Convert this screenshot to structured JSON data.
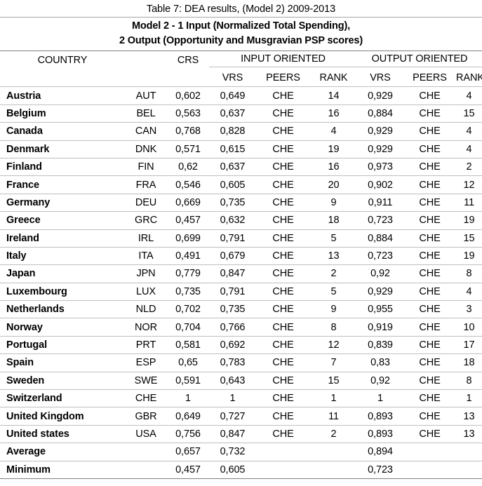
{
  "caption": "Table 7: DEA results, (Model 2) 2009-2013",
  "title": {
    "line1": "Model 2 - 1 Input (Normalized Total Spending),",
    "line2": "2 Output (Opportunity and Musgravian PSP scores)"
  },
  "header": {
    "country": "COUNTRY",
    "code": "",
    "crs": "CRS",
    "group_input": "INPUT ORIENTED",
    "group_output": "OUTPUT ORIENTED",
    "sub": {
      "input_vrs": "VRS",
      "input_peers": "PEERS",
      "input_rank": "RANK",
      "output_vrs": "VRS",
      "output_peers": "PEERS",
      "output_rank": "RANK"
    }
  },
  "rows": [
    {
      "country": "Austria",
      "code": "AUT",
      "crs": "0,602",
      "input_vrs": "0,649",
      "input_peers": "CHE",
      "input_rank": "14",
      "output_vrs": "0,929",
      "output_peers": "CHE",
      "output_rank": "4"
    },
    {
      "country": "Belgium",
      "code": "BEL",
      "crs": "0,563",
      "input_vrs": "0,637",
      "input_peers": "CHE",
      "input_rank": "16",
      "output_vrs": "0,884",
      "output_peers": "CHE",
      "output_rank": "15"
    },
    {
      "country": "Canada",
      "code": "CAN",
      "crs": "0,768",
      "input_vrs": "0,828",
      "input_peers": "CHE",
      "input_rank": "4",
      "output_vrs": "0,929",
      "output_peers": "CHE",
      "output_rank": "4"
    },
    {
      "country": "Denmark",
      "code": "DNK",
      "crs": "0,571",
      "input_vrs": "0,615",
      "input_peers": "CHE",
      "input_rank": "19",
      "output_vrs": "0,929",
      "output_peers": "CHE",
      "output_rank": "4"
    },
    {
      "country": "Finland",
      "code": "FIN",
      "crs": "0,62",
      "input_vrs": "0,637",
      "input_peers": "CHE",
      "input_rank": "16",
      "output_vrs": "0,973",
      "output_peers": "CHE",
      "output_rank": "2"
    },
    {
      "country": "France",
      "code": "FRA",
      "crs": "0,546",
      "input_vrs": "0,605",
      "input_peers": "CHE",
      "input_rank": "20",
      "output_vrs": "0,902",
      "output_peers": "CHE",
      "output_rank": "12"
    },
    {
      "country": "Germany",
      "code": "DEU",
      "crs": "0,669",
      "input_vrs": "0,735",
      "input_peers": "CHE",
      "input_rank": "9",
      "output_vrs": "0,911",
      "output_peers": "CHE",
      "output_rank": "11"
    },
    {
      "country": "Greece",
      "code": "GRC",
      "crs": "0,457",
      "input_vrs": "0,632",
      "input_peers": "CHE",
      "input_rank": "18",
      "output_vrs": "0,723",
      "output_peers": "CHE",
      "output_rank": "19"
    },
    {
      "country": "Ireland",
      "code": "IRL",
      "crs": "0,699",
      "input_vrs": "0,791",
      "input_peers": "CHE",
      "input_rank": "5",
      "output_vrs": "0,884",
      "output_peers": "CHE",
      "output_rank": "15"
    },
    {
      "country": "Italy",
      "code": "ITA",
      "crs": "0,491",
      "input_vrs": "0,679",
      "input_peers": "CHE",
      "input_rank": "13",
      "output_vrs": "0,723",
      "output_peers": "CHE",
      "output_rank": "19"
    },
    {
      "country": "Japan",
      "code": "JPN",
      "crs": "0,779",
      "input_vrs": "0,847",
      "input_peers": "CHE",
      "input_rank": "2",
      "output_vrs": "0,92",
      "output_peers": "CHE",
      "output_rank": "8"
    },
    {
      "country": "Luxembourg",
      "code": "LUX",
      "crs": "0,735",
      "input_vrs": "0,791",
      "input_peers": "CHE",
      "input_rank": "5",
      "output_vrs": "0,929",
      "output_peers": "CHE",
      "output_rank": "4"
    },
    {
      "country": "Netherlands",
      "code": "NLD",
      "crs": "0,702",
      "input_vrs": "0,735",
      "input_peers": "CHE",
      "input_rank": "9",
      "output_vrs": "0,955",
      "output_peers": "CHE",
      "output_rank": "3"
    },
    {
      "country": "Norway",
      "code": "NOR",
      "crs": "0,704",
      "input_vrs": "0,766",
      "input_peers": "CHE",
      "input_rank": "8",
      "output_vrs": "0,919",
      "output_peers": "CHE",
      "output_rank": "10"
    },
    {
      "country": "Portugal",
      "code": "PRT",
      "crs": "0,581",
      "input_vrs": "0,692",
      "input_peers": "CHE",
      "input_rank": "12",
      "output_vrs": "0,839",
      "output_peers": "CHE",
      "output_rank": "17"
    },
    {
      "country": "Spain",
      "code": "ESP",
      "crs": "0,65",
      "input_vrs": "0,783",
      "input_peers": "CHE",
      "input_rank": "7",
      "output_vrs": "0,83",
      "output_peers": "CHE",
      "output_rank": "18"
    },
    {
      "country": "Sweden",
      "code": "SWE",
      "crs": "0,591",
      "input_vrs": "0,643",
      "input_peers": "CHE",
      "input_rank": "15",
      "output_vrs": "0,92",
      "output_peers": "CHE",
      "output_rank": "8"
    },
    {
      "country": "Switzerland",
      "code": "CHE",
      "crs": "1",
      "input_vrs": "1",
      "input_peers": "CHE",
      "input_rank": "1",
      "output_vrs": "1",
      "output_peers": "CHE",
      "output_rank": "1"
    },
    {
      "country": "United Kingdom",
      "code": "GBR",
      "crs": "0,649",
      "input_vrs": "0,727",
      "input_peers": "CHE",
      "input_rank": "11",
      "output_vrs": "0,893",
      "output_peers": "CHE",
      "output_rank": "13"
    },
    {
      "country": "United states",
      "code": "USA",
      "crs": "0,756",
      "input_vrs": "0,847",
      "input_peers": "CHE",
      "input_rank": "2",
      "output_vrs": "0,893",
      "output_peers": "CHE",
      "output_rank": "13"
    }
  ],
  "summary": [
    {
      "country": "Average",
      "code": "",
      "crs": "0,657",
      "input_vrs": "0,732",
      "input_peers": "",
      "input_rank": "",
      "output_vrs": "0,894",
      "output_peers": "",
      "output_rank": ""
    },
    {
      "country": "Minimum",
      "code": "",
      "crs": "0,457",
      "input_vrs": "0,605",
      "input_peers": "",
      "input_rank": "",
      "output_vrs": "0,723",
      "output_peers": "",
      "output_rank": ""
    }
  ],
  "colors": {
    "rule_strong": "#808080",
    "rule_light": "#bfbfbf",
    "text": "#000000",
    "background": "#ffffff"
  }
}
